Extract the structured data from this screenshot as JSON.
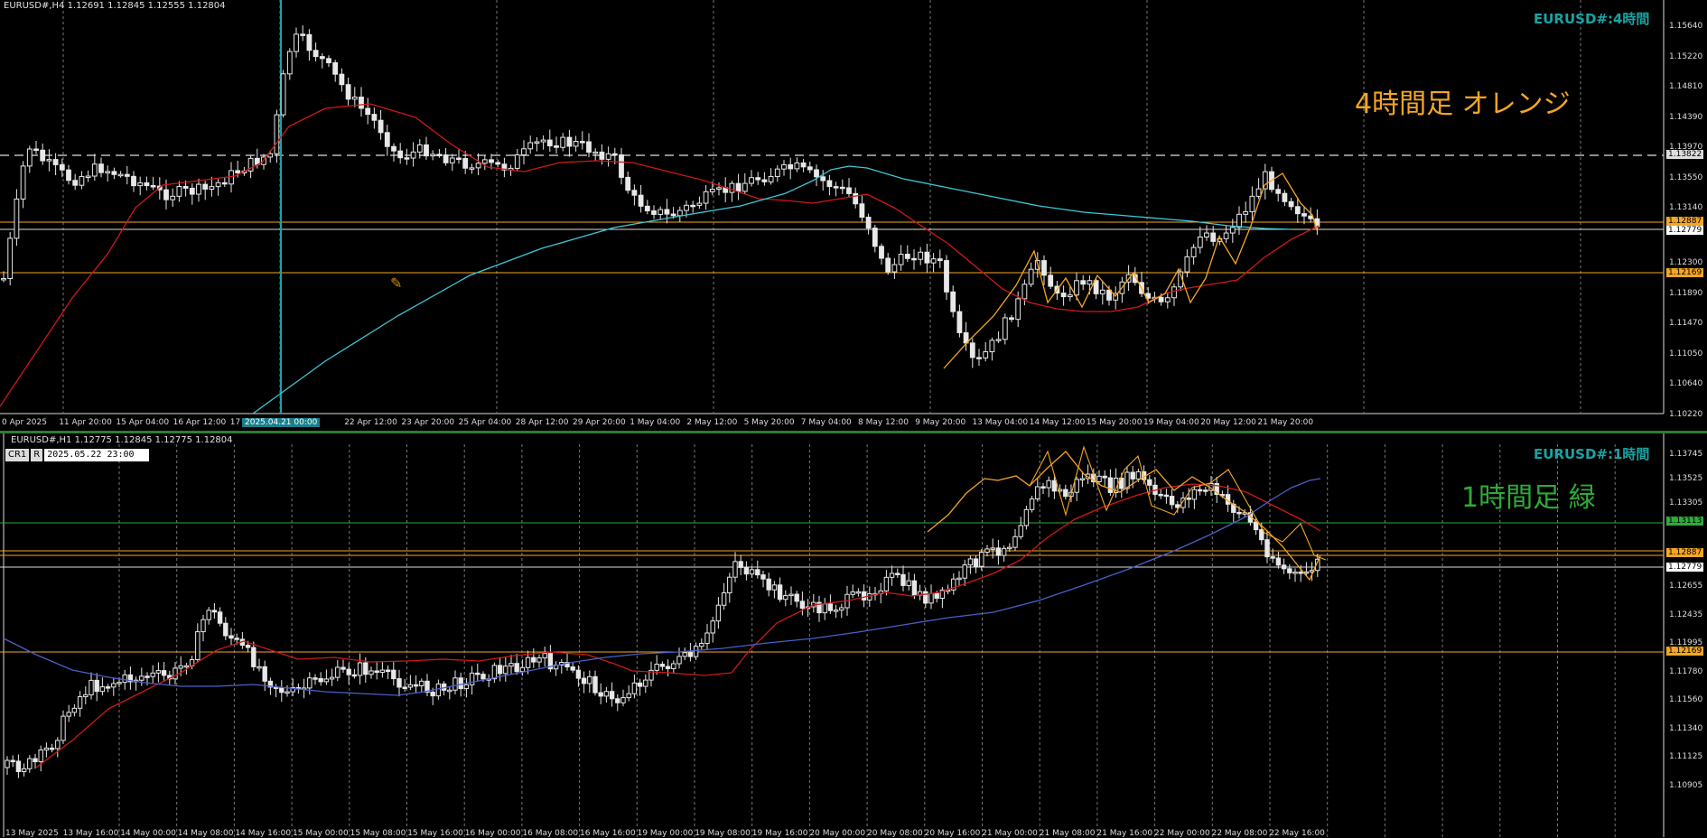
{
  "top_chart": {
    "header": "EURUSD#,H4  1.12691 1.12845 1.12555 1.12804",
    "watermark": "EURUSD#:4時間",
    "annotation": "4時間足  オレンジ",
    "price_ticks": [
      "1.15640",
      "1.15220",
      "1.14810",
      "1.14390",
      "1.13970",
      "1.13550",
      "1.13140",
      "1.12300",
      "1.11890",
      "1.11470",
      "1.11050",
      "1.10640",
      "1.10220"
    ],
    "price_badges": {
      "orange_high": "1.12887",
      "current": "1.12779",
      "orange_low": "1.12169",
      "dashed": "1.13822"
    },
    "time_ticks": [
      "0 Apr 2025",
      "11 Apr 20:00",
      "15 Apr 04:00",
      "16 Apr 12:00",
      "17",
      "04:00",
      "22 Apr 12:00",
      "23 Apr 20:00",
      "25 Apr 04:00",
      "28 Apr 12:00",
      "29 Apr 20:00",
      "1 May 04:00",
      "2 May 12:00",
      "5 May 20:00",
      "7 May 04:00",
      "8 May 12:00",
      "9 May 20:00",
      "13 May 04:00",
      "14 May 12:00",
      "15 May 20:00",
      "19 May 04:00",
      "20 May 12:00",
      "21 May 20:00"
    ],
    "cursor_time": "2025.04.21 00:00"
  },
  "bottom_chart": {
    "header": "EURUSD#,H1  1.12775 1.12845 1.12775 1.12804",
    "watermark": "EURUSD#:1時間",
    "annotation": "1時間足  緑",
    "cr_label": "CR1",
    "r_label": "R",
    "crosshair_datetime": "2025.05.22 23:00",
    "price_ticks": [
      "1.13745",
      "1.13525",
      "1.13305",
      "1.12655",
      "1.12435",
      "1.11995",
      "1.11780",
      "1.11560",
      "1.11340",
      "1.11125",
      "1.10905"
    ],
    "price_badges": {
      "green": "1.13113",
      "orange_high": "1.12887",
      "current": "1.12779",
      "orange_low": "1.12169"
    },
    "time_ticks": [
      "13 May 2025",
      "13 May 16:00",
      "14 May 00:00",
      "14 May 08:00",
      "14 May 16:00",
      "15 May 00:00",
      "15 May 08:00",
      "15 May 16:00",
      "16 May 00:00",
      "16 May 08:00",
      "16 May 16:00",
      "19 May 00:00",
      "19 May 08:00",
      "19 May 16:00",
      "20 May 00:00",
      "20 May 08:00",
      "20 May 16:00",
      "21 May 00:00",
      "21 May 08:00",
      "21 May 16:00",
      "22 May 00:00",
      "22 May 08:00",
      "22 May 16:00"
    ]
  },
  "colors": {
    "orange": "#f5a623",
    "green": "#2eaa3a",
    "teal": "#1aa3a3",
    "ma_red": "#d01818",
    "ma_cyan": "#3cc8d8",
    "ma_blue": "#4a5fc8",
    "candle": "#e8e8e8"
  }
}
